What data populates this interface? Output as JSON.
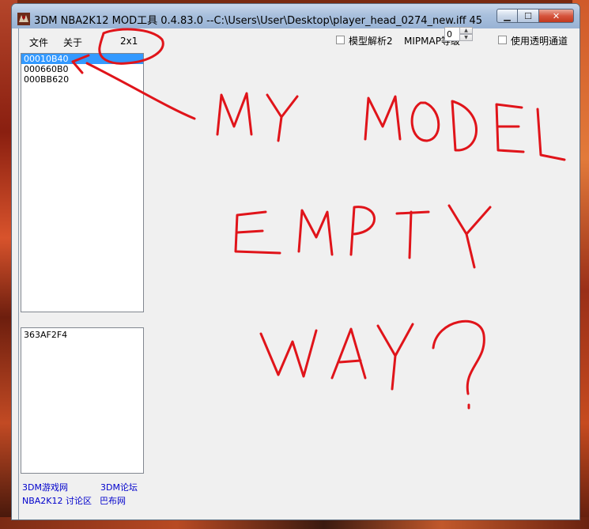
{
  "window": {
    "title": "3DM NBA2K12 MOD工具 0.4.83.0 --C:\\Users\\User\\Desktop\\player_head_0274_new.iff  45",
    "caption": {
      "minimize": "▁",
      "maximize": "☐",
      "close": "✕"
    }
  },
  "menu": {
    "file": "文件",
    "about": "关于",
    "extra": "2x1"
  },
  "options": {
    "model_parse_label": "模型解析2",
    "mipmap_label": "MIPMAP等级",
    "mipmap_value": "0",
    "transparency_label": "使用透明通道"
  },
  "lists": {
    "top": [
      "00010B40",
      "000660B0",
      "000BB620"
    ],
    "bottom": [
      "363AF2F4"
    ]
  },
  "links": {
    "site": "3DM游戏网",
    "forum": "3DM论坛",
    "discussion": "NBA2K12 讨论区",
    "babu": "巴布网"
  },
  "icons": {
    "app": "app-icon",
    "spin_up": "spin-up-icon",
    "spin_down": "spin-down-icon"
  },
  "annotation": {
    "color": "#e0141a",
    "text_lines": [
      "MY MODEL",
      "EMPTY",
      "WAY?"
    ]
  }
}
